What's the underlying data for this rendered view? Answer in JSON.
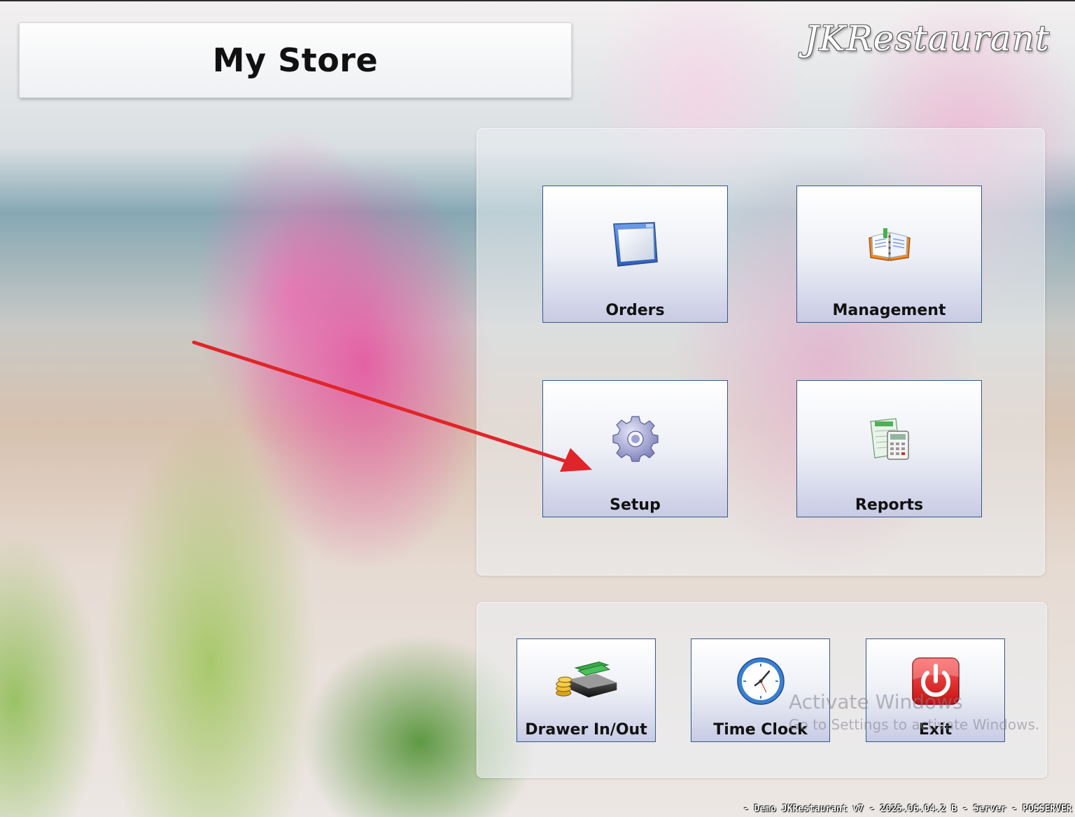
{
  "header": {
    "store_title": "My Store",
    "brand": "JKRestaurant"
  },
  "main_menu": {
    "orders_label": "Orders",
    "management_label": "Management",
    "setup_label": "Setup",
    "reports_label": "Reports"
  },
  "bottom_menu": {
    "drawer_label": "Drawer In/Out",
    "time_clock_label": "Time Clock",
    "exit_label": "Exit"
  },
  "watermark": {
    "title": "Activate Windows",
    "subtitle": "Go to Settings to activate Windows."
  },
  "status_bar": {
    "text": "- Demo JKRestaurant v7 - 2025.06.04.2 B - Server - POSSERVER"
  },
  "colors": {
    "tile_border": "#34588a",
    "arrow": "#e0252a"
  },
  "icons": {
    "orders": "window-icon",
    "management": "open-book-icon",
    "setup": "gear-icon",
    "reports": "calculator-spreadsheet-icon",
    "drawer": "cash-drawer-icon",
    "time_clock": "clock-icon",
    "exit": "power-icon"
  }
}
